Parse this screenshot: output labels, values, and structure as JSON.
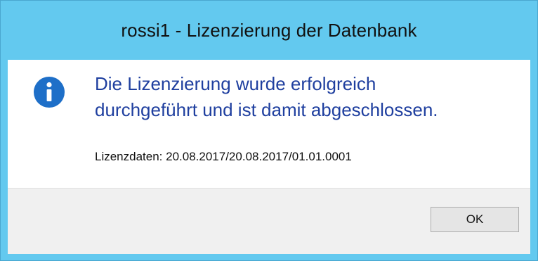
{
  "window": {
    "title": "rossi1 - Lizenzierung der Datenbank"
  },
  "message": {
    "icon": "info-icon",
    "line1": "Die Lizenzierung wurde erfolgreich",
    "line2": "durchgeführt und ist damit abgeschlossen.",
    "license_data": "Lizenzdaten: 20.08.2017/20.08.2017/01.01.0001"
  },
  "buttons": {
    "ok_label": "OK"
  },
  "colors": {
    "titlebar": "#63c9ef",
    "message_text": "#1f3f9f",
    "icon_fill": "#1e6fc8",
    "footer": "#f0f0f0"
  }
}
